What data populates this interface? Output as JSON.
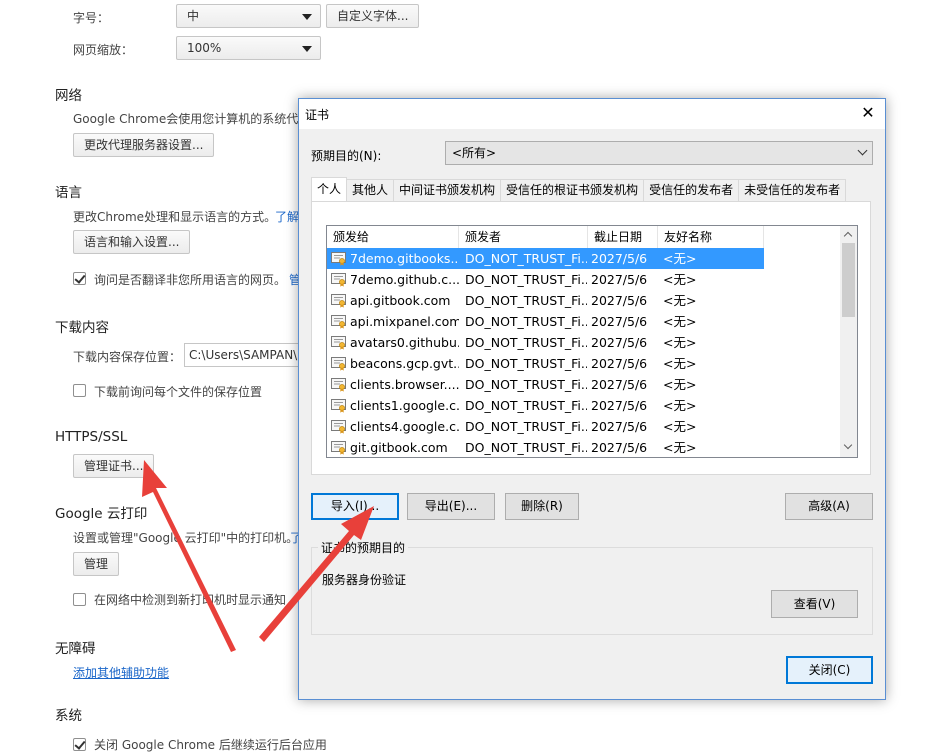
{
  "settings": {
    "font_size_label": "字号：",
    "font_size_value": "中",
    "custom_fonts_button": "自定义字体...",
    "zoom_label": "网页缩放：",
    "zoom_value": "100%",
    "network": {
      "title": "网络",
      "description": "Google Chrome会使用您计算机的系统代理",
      "proxy_button": "更改代理服务器设置..."
    },
    "language": {
      "title": "语言",
      "description": "更改Chrome处理和显示语言的方式。",
      "learn_more": "了解",
      "settings_button": "语言和输入设置...",
      "translate_checkbox_label": "询问是否翻译非您所用语言的网页。",
      "translate_checkbox_checked": true,
      "manage_link": "管"
    },
    "downloads": {
      "title": "下载内容",
      "location_label": "下载内容保存位置：",
      "location_value": "C:\\Users\\SAMPAN\\D",
      "ask_checkbox_label": "下载前询问每个文件的保存位置",
      "ask_checkbox_checked": false
    },
    "https": {
      "title": "HTTPS/SSL",
      "manage_certs_button": "管理证书..."
    },
    "cloud_print": {
      "title": "Google 云打印",
      "description": "设置或管理\"Google 云打印\"中的打印机。",
      "learn_more": "了",
      "manage_button": "管理",
      "notify_checkbox_label": "在网络中检测到新打印机时显示通知",
      "notify_checkbox_checked": false
    },
    "accessibility": {
      "title": "无障碍",
      "add_features_link": "添加其他辅助功能"
    },
    "system": {
      "title": "系统",
      "background_checkbox_label": "关闭 Google Chrome 后继续运行后台应用",
      "background_checkbox_checked": true
    }
  },
  "dialog": {
    "title": "证书",
    "close_glyph": "✕",
    "purpose_label": "预期目的(N):",
    "purpose_value": "<所有>",
    "tabs": [
      {
        "label": "个人",
        "active": true
      },
      {
        "label": "其他人",
        "active": false
      },
      {
        "label": "中间证书颁发机构",
        "active": false
      },
      {
        "label": "受信任的根证书颁发机构",
        "active": false
      },
      {
        "label": "受信任的发布者",
        "active": false
      },
      {
        "label": "未受信任的发布者",
        "active": false
      }
    ],
    "columns": [
      "颁发给",
      "颁发者",
      "截止日期",
      "友好名称"
    ],
    "rows": [
      {
        "issued_to": "7demo.gitbooks...",
        "issuer": "DO_NOT_TRUST_Fi...",
        "expires": "2027/5/6",
        "friendly": "<无>",
        "selected": true
      },
      {
        "issued_to": "7demo.github.c...",
        "issuer": "DO_NOT_TRUST_Fi...",
        "expires": "2027/5/6",
        "friendly": "<无>",
        "selected": false
      },
      {
        "issued_to": "api.gitbook.com",
        "issuer": "DO_NOT_TRUST_Fi...",
        "expires": "2027/5/6",
        "friendly": "<无>",
        "selected": false
      },
      {
        "issued_to": "api.mixpanel.com",
        "issuer": "DO_NOT_TRUST_Fi...",
        "expires": "2027/5/6",
        "friendly": "<无>",
        "selected": false
      },
      {
        "issued_to": "avatars0.githubu...",
        "issuer": "DO_NOT_TRUST_Fi...",
        "expires": "2027/5/6",
        "friendly": "<无>",
        "selected": false
      },
      {
        "issued_to": "beacons.gcp.gvt...",
        "issuer": "DO_NOT_TRUST_Fi...",
        "expires": "2027/5/6",
        "friendly": "<无>",
        "selected": false
      },
      {
        "issued_to": "clients.browser....",
        "issuer": "DO_NOT_TRUST_Fi...",
        "expires": "2027/5/6",
        "friendly": "<无>",
        "selected": false
      },
      {
        "issued_to": "clients1.google.c...",
        "issuer": "DO_NOT_TRUST_Fi...",
        "expires": "2027/5/6",
        "friendly": "<无>",
        "selected": false
      },
      {
        "issued_to": "clients4.google.c...",
        "issuer": "DO_NOT_TRUST_Fi...",
        "expires": "2027/5/6",
        "friendly": "<无>",
        "selected": false
      },
      {
        "issued_to": "git.gitbook.com",
        "issuer": "DO_NOT_TRUST_Fi...",
        "expires": "2027/5/6",
        "friendly": "<无>",
        "selected": false
      }
    ],
    "buttons": {
      "import": "导入(I)...",
      "export": "导出(E)...",
      "remove": "删除(R)",
      "advanced": "高级(A)",
      "view": "查看(V)",
      "close": "关闭(C)"
    },
    "purposes_group": {
      "legend": "证书的预期目的",
      "value": "服务器身份验证"
    }
  },
  "colors": {
    "selection": "#3399ff",
    "link": "#1a66c9",
    "annotation_arrow": "#e8403a",
    "dialog_border": "#5a8fd3"
  },
  "icons": [
    "certificate-icon",
    "close-icon",
    "chevron-down-icon",
    "checkbox-check-icon",
    "red-annotation-arrow"
  ]
}
